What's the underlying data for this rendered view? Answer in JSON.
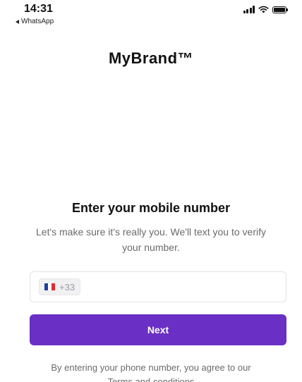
{
  "status_bar": {
    "time": "14:31",
    "back_label": "WhatsApp",
    "icons": [
      "cellular-signal-icon",
      "wifi-icon",
      "battery-icon"
    ]
  },
  "brand": {
    "name": "MyBrand™"
  },
  "form": {
    "heading": "Enter your mobile number",
    "subtext": "Let's make sure it's really you. We'll text you to verify your number.",
    "country_flag": "france-flag-icon",
    "country_code": "+33",
    "phone_value": "",
    "next_label": "Next"
  },
  "legal": {
    "text": "By entering your phone number, you agree to our",
    "terms_link": "Terms and conditions"
  },
  "colors": {
    "primary": "#6a2fc4",
    "flag_blue": "#1f3fa0",
    "flag_red": "#e02b2b"
  }
}
